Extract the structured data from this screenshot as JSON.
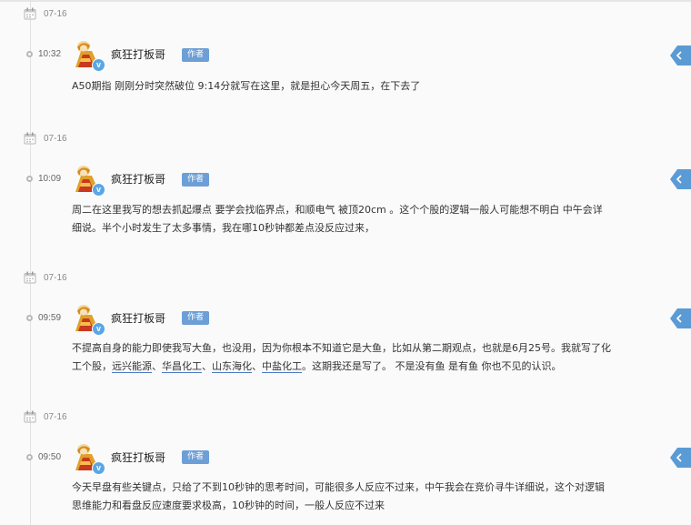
{
  "posts": [
    {
      "date": "07-16",
      "time": "10:32",
      "username": "疯狂打板哥",
      "badge": "作者",
      "lines": [
        "A50期指 刚刚分时突然破位 9:14分就写在这里，就是担心今天周五，在下去了"
      ]
    },
    {
      "date": "07-16",
      "time": "10:09",
      "username": "疯狂打板哥",
      "badge": "作者",
      "lines": [
        "周二在这里我写的想去抓起爆点 要学会找临界点，和顺电气 被顶20cm 。这个个股的逻辑一般人可能想不明白  中午会详",
        "细说。半个小时发生了太多事情，我在哪10秒钟都差点没反应过来，"
      ]
    },
    {
      "date": "07-16",
      "time": "09:59",
      "username": "疯狂打板哥",
      "badge": "作者",
      "line1": "不提高自身的能力即使我写大鱼，也没用，因为你根本不知道它是大鱼，比如从第二期观点，也就是6月25号。我就写了化",
      "line2_prefix": "工个股，",
      "stocks": [
        "远兴能源",
        "华昌化工",
        "山东海化",
        "中盐化工"
      ],
      "separator": "、",
      "line2_suffix": "。这期我还是写了。 不是没有鱼  是有鱼 你也不见的认识。"
    },
    {
      "date": "07-16",
      "time": "09:50",
      "username": "疯狂打板哥",
      "badge": "作者",
      "lines": [
        "今天早盘有些关键点，只给了不到10秒钟的思考时间，可能很多人反应不过来，中午我会在竞价寻牛详细说，这个对逻辑",
        "思维能力和看盘反应速度要求极高，10秒钟的时间，一般人反应不过来"
      ]
    }
  ],
  "colors": {
    "author_badge": "#6d9fd6",
    "side_tab": "#5b9bd5",
    "verify": "#5aa6e6"
  },
  "icons": {
    "date": "calendar-icon",
    "time": "timeline-dot-icon",
    "verify": "verified-v-icon",
    "side": "side-tab-arrow-icon"
  },
  "verify_mark": "v"
}
